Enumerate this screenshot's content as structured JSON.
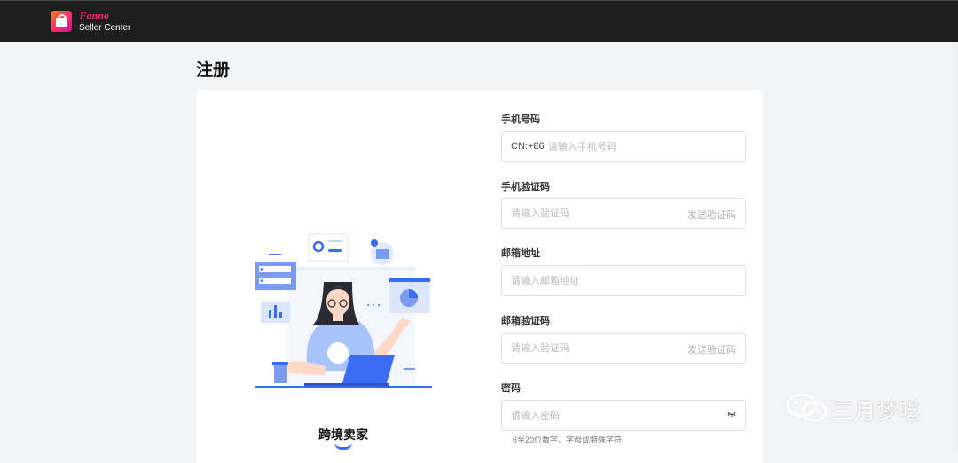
{
  "header": {
    "brand": "Fanno",
    "subtitle": "Seller Center"
  },
  "page": {
    "title": "注册"
  },
  "illustration": {
    "label": "跨境卖家"
  },
  "form": {
    "phone": {
      "label": "手机号码",
      "prefix": "CN:+86",
      "placeholder": "请输入手机号码"
    },
    "phone_code": {
      "label": "手机验证码",
      "placeholder": "请输入验证码",
      "send_label": "发送验证码"
    },
    "email": {
      "label": "邮箱地址",
      "placeholder": "请输入邮箱地址"
    },
    "email_code": {
      "label": "邮箱验证码",
      "placeholder": "请输入验证码",
      "send_label": "发送验证码"
    },
    "password": {
      "label": "密码",
      "placeholder": "请输入密码",
      "hint": "6至20位数字、字母或特殊字符"
    }
  },
  "watermark": {
    "text": "三月梦呓"
  },
  "colors": {
    "topbar": "#1e1e1e",
    "accent": "#3b6cf6",
    "brand": "#ff2f6d"
  }
}
